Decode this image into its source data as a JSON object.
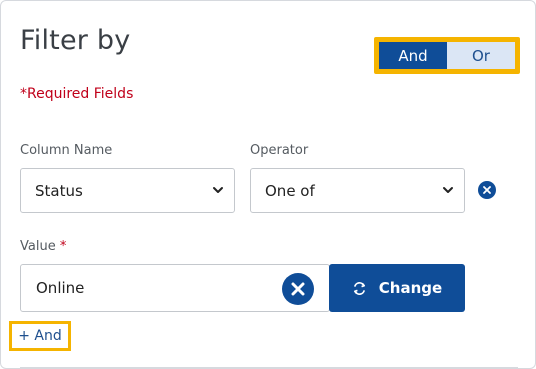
{
  "header": {
    "title": "Filter by"
  },
  "logic_toggle": {
    "and_label": "And",
    "or_label": "Or",
    "selected": "And"
  },
  "form": {
    "required_note": "*Required Fields",
    "column_name": {
      "label": "Column Name",
      "value": "Status"
    },
    "operator": {
      "label": "Operator",
      "value": "One of"
    },
    "value_field": {
      "label": "Value",
      "required_mark": "*",
      "value": "Online"
    },
    "change_button": "Change",
    "add_and_link": "+ And"
  },
  "colors": {
    "primary": "#0f4d98",
    "highlight": "#f5b400",
    "required": "#c0001a"
  },
  "icons": [
    "chevron-down-icon",
    "remove-icon",
    "clear-icon",
    "refresh-icon"
  ]
}
